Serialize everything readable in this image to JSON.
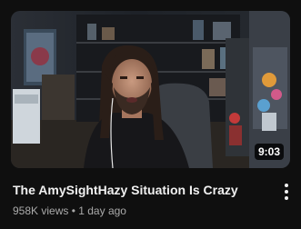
{
  "video": {
    "duration": "9:03",
    "title": "The AmySightHazy Situation Is Crazy",
    "views": "958K views",
    "separator": " • ",
    "age": "1 day ago"
  },
  "icons": {
    "more_actions": "more-vertical-icon"
  },
  "colors": {
    "background": "#0f0f0f",
    "title_text": "#f1f1f1",
    "meta_text": "#aaaaaa",
    "duration_badge": "#000000"
  }
}
